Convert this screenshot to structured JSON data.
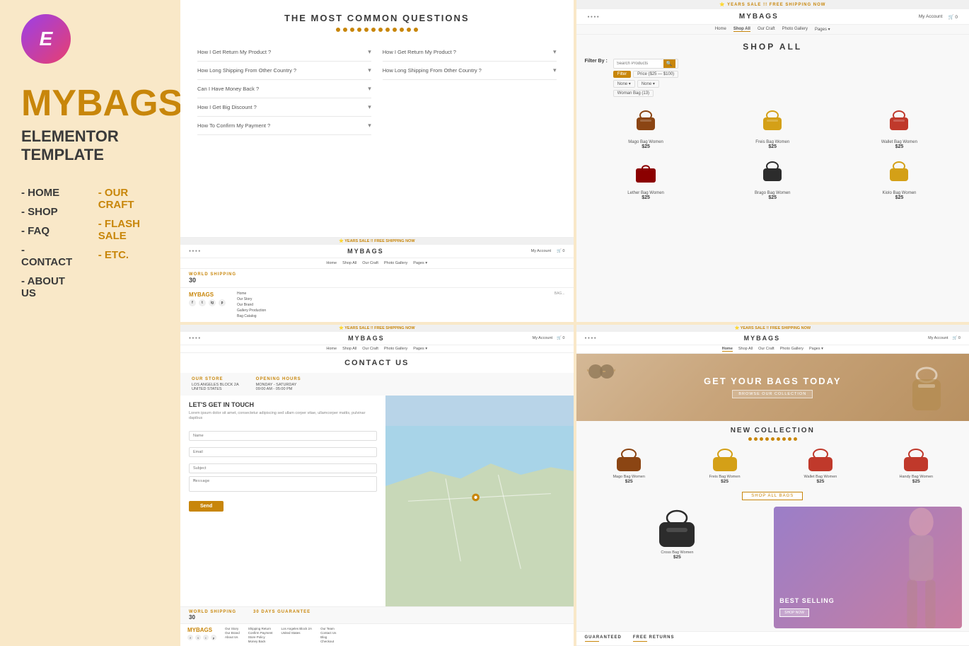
{
  "brand": "MYBAGS",
  "elementor_logo": "E",
  "left_panel": {
    "brand_name": "MYBAGS",
    "template_label": "ELEMENTOR TEMPLATE",
    "pages_col1": [
      {
        "label": "- HOME"
      },
      {
        "label": "- SHOP"
      },
      {
        "label": "- FAQ"
      },
      {
        "label": "- CONTACT"
      },
      {
        "label": "- ABOUT US"
      }
    ],
    "pages_col2": [
      {
        "label": "- OUR CRAFT",
        "gold": true
      },
      {
        "label": "- FLASH SALE",
        "gold": true
      },
      {
        "label": "- ETC.",
        "gold": true
      }
    ]
  },
  "faq_page": {
    "title": "THE MOST COMMON QUESTIONS",
    "questions_col1": [
      "How I Get Return My Product ?",
      "How Long Shipping From Other Country ?",
      "Can I Have Money Back ?",
      "How I Get Big Discount ?",
      "How To Confirm My Payment ?"
    ],
    "questions_col2": [
      "How I Get Return My Product ?",
      "How Long Shipping From Other Country ?"
    ]
  },
  "shop_page": {
    "banner": "YEARS SALE !! FREE SHIPPING NOW",
    "nav": {
      "brand": "MYBAGS",
      "links": [
        "Home",
        "Shop All",
        "Our Craft",
        "Photo Gallery",
        "Pages"
      ],
      "active": "Shop All",
      "my_account": "My Account"
    },
    "title": "SHOP ALL",
    "filter": {
      "label": "Filter By :",
      "search_placeholder": "Search Products",
      "tags": [
        "Price ($25 — $100)"
      ],
      "dropdowns": [
        "None",
        "None",
        "Woman Bag (13)"
      ]
    },
    "products": [
      {
        "name": "Mago Bag Women",
        "price": "$25",
        "color": "#8B4513"
      },
      {
        "name": "Freis Bag Women",
        "price": "$25",
        "color": "#D4A017"
      },
      {
        "name": "Wallet Bag Women",
        "price": "$25",
        "color": "#C0392B"
      },
      {
        "name": "Lether Bag Women",
        "price": "$25",
        "color": "#8B0000"
      },
      {
        "name": "Brago Bag Women",
        "price": "$25",
        "color": "#2C2C2C"
      },
      {
        "name": "Kiolo Bag Women",
        "price": "$25",
        "color": "#D4A017"
      }
    ]
  },
  "contact_page": {
    "banner": "YEARS SALE !! FREE SHIPPING NOW",
    "title": "CONTACT US",
    "nav": {
      "brand": "MYBAGS",
      "links": [
        "Home",
        "Shop All",
        "Our Craft",
        "Photo Gallery",
        "Pages"
      ]
    },
    "our_store": {
      "label": "OUR STORE",
      "address": "LOS ANGELES BLOCK 2A\nUNITED STATES"
    },
    "opening_hours": {
      "label": "OPENING HOURS",
      "hours": "MONDAY - SATURDAY\n09:00 AM - 05:00 PM"
    },
    "form": {
      "title": "LET'S GET IN TOUCH",
      "subtitle": "Lorem ipsum dolor sit amet, consectetur adipiscing sed ullam corper vitae, ullamcorper mattis, pulvinar dapibus",
      "fields": [
        "Name",
        "Email",
        "Subject",
        "Message"
      ],
      "send_btn": "Send"
    },
    "footer": {
      "brand": "MYBAGS",
      "col1": [
        "Our Story",
        "Our Brand",
        "About Us"
      ],
      "col2": [
        "Shipping Return",
        "Confirm Payment",
        "Store Policy",
        "Money Back"
      ],
      "col3": [
        "Los Angeles Block 2A",
        "United States"
      ],
      "col4": [
        "Our Team",
        "Contact Us",
        "Blog",
        "Checkout"
      ]
    },
    "world_shipping_bar": {
      "world_shipping": "WORLD SHIPPING",
      "world_shipping_value": "30",
      "days_guarantee": "30 DAYS GUARANTEE"
    }
  },
  "home_page": {
    "banner": "YEARS SALE !! FREE SHIPPING NOW",
    "nav": {
      "brand": "MYBAGS",
      "links": [
        "Home",
        "Shop All",
        "Our Craft",
        "Photo Gallery",
        "Pages"
      ],
      "active": "Home"
    },
    "hero": {
      "title": "GET YOUR BAGS TODAY",
      "btn": "BROWSE OUR COLLECTION"
    },
    "new_collection": {
      "title": "NEW COLLECTION",
      "products": [
        {
          "name": "Mago Bag Women",
          "price": "$25",
          "color": "#8B4513"
        },
        {
          "name": "Freis Bag Women",
          "price": "$25",
          "color": "#D4A017"
        },
        {
          "name": "Wallet Bag Women",
          "price": "$25",
          "color": "#C0392B"
        },
        {
          "name": "Handy Bag Women",
          "price": "$25",
          "color": "#C0392B"
        }
      ],
      "shop_all_btn": "SHOP ALL BAGS"
    },
    "best_selling": {
      "title": "BEST SELLING",
      "btn": "SHOP NOW",
      "product": {
        "name": "Cross Bag Women",
        "price": "$25",
        "color": "#2C2C2C"
      }
    },
    "guarantee": {
      "items": [
        "GUARANTEED",
        "FREE RETURNS"
      ]
    }
  }
}
